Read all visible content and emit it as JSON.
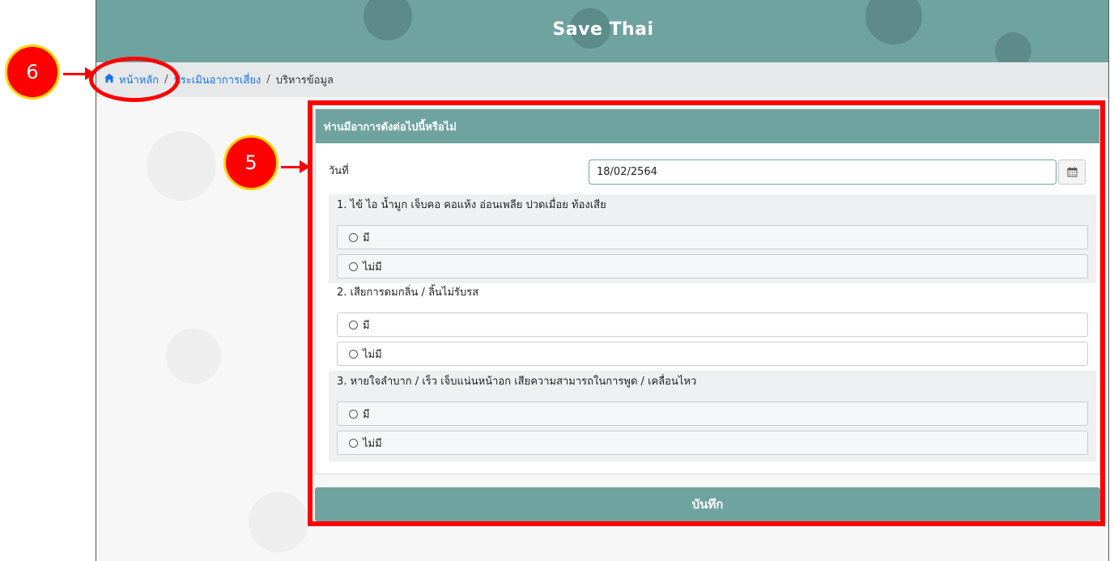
{
  "app": {
    "title": "Save Thai"
  },
  "breadcrumb": {
    "home_icon": "home-icon",
    "home": "หน้าหลัก",
    "sep": "/",
    "assess": "ประเมินอาการเสี่ยง",
    "current": "บริหารข้อมูล"
  },
  "form": {
    "header": "ท่านมีอาการดังต่อไปนี้หรือไม่",
    "date_label": "วันที่",
    "date_value": "18/02/2564",
    "calendar_icon": "calendar-icon",
    "questions": [
      {
        "text": "1. ไข้ ไอ น้ำมูก เจ็บคอ คอแห้ง อ่อนเพลีย ปวดเมื่อย ท้องเสีย",
        "options": [
          "มี",
          "ไม่มี"
        ]
      },
      {
        "text": "2. เสียการดมกลิ่น / ลิ้นไม่รับรส",
        "options": [
          "มี",
          "ไม่มี"
        ]
      },
      {
        "text": "3. หายใจลำบาก / เร็ว เจ็บแน่นหน้าอก เสียความสามารถในการพูด / เคลื่อนไหว",
        "options": [
          "มี",
          "ไม่มี"
        ]
      }
    ],
    "save_label": "บันทึก"
  },
  "annotations": {
    "badge_5": "5",
    "badge_6": "6",
    "highlight_color": "#ff0000"
  },
  "colors": {
    "accent": "#6fa3a0",
    "link": "#1a73e8"
  }
}
